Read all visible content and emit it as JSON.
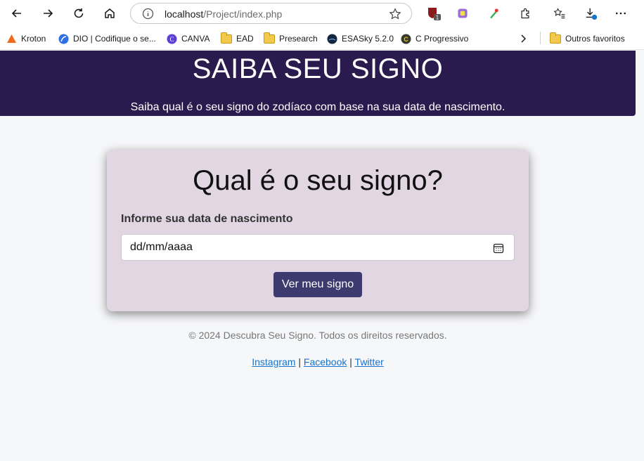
{
  "browser": {
    "url_host": "localhost",
    "url_path": "/Project/index.php",
    "bookmarks": [
      {
        "label": "Kroton",
        "icon": "kroton-icon"
      },
      {
        "label": "DIO | Codifique o se...",
        "icon": "dio-icon"
      },
      {
        "label": "CANVA",
        "icon": "canva-icon"
      },
      {
        "label": "EAD",
        "icon": "folder-icon"
      },
      {
        "label": "Presearch",
        "icon": "folder-icon"
      },
      {
        "label": "ESASky 5.2.0",
        "icon": "esasky-icon"
      },
      {
        "label": "C Progressivo",
        "icon": "cprogressivo-icon"
      }
    ],
    "other_favorites": "Outros favoritos",
    "extension_badge": "1",
    "colors": {
      "chrome_bg": "#ffffff"
    }
  },
  "header": {
    "title": "SAIBA SEU SIGNO",
    "subtitle": "Saiba qual é o seu signo do zodíaco com base na sua data de nascimento.",
    "bg_color": "#2b1a4e"
  },
  "form": {
    "heading": "Qual é o seu signo?",
    "label": "Informe sua data de nascimento",
    "date_placeholder": "dd/mm/aaaa",
    "button": "Ver meu signo",
    "card_color": "#e2d6e3",
    "button_color": "#3c3a6e"
  },
  "footer": {
    "copyright": "© 2024 Descubra Seu Signo. Todos os direitos reservados.",
    "links": [
      "Instagram",
      "Facebook",
      "Twitter"
    ],
    "separator": "|"
  }
}
